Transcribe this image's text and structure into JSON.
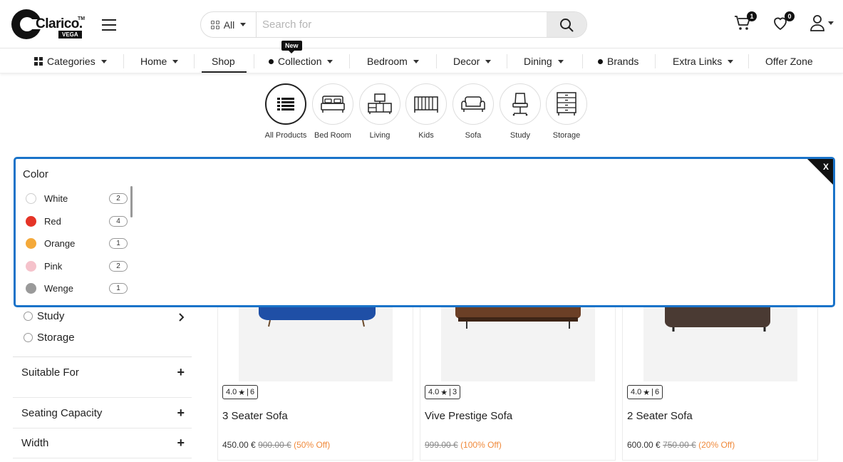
{
  "header": {
    "logo_text": "Clarico.",
    "logo_tm": "TM",
    "logo_sub": "VEGA",
    "search": {
      "category": "All",
      "placeholder": "Search for"
    },
    "cart_count": "1",
    "wishlist_count": "0"
  },
  "nav": {
    "categories": "Categories",
    "home": "Home",
    "shop": "Shop",
    "collection": "Collection",
    "new_badge": "New",
    "bedroom": "Bedroom",
    "decor": "Decor",
    "dining": "Dining",
    "brands": "Brands",
    "extra_links": "Extra Links",
    "offer_zone": "Offer Zone"
  },
  "categories": [
    {
      "label": "All Products",
      "icon": "list-icon"
    },
    {
      "label": "Bed Room",
      "icon": "bed-icon"
    },
    {
      "label": "Living",
      "icon": "tv-unit-icon"
    },
    {
      "label": "Kids",
      "icon": "crib-icon"
    },
    {
      "label": "Sofa",
      "icon": "sofa-icon"
    },
    {
      "label": "Study",
      "icon": "office-chair-icon"
    },
    {
      "label": "Storage",
      "icon": "cabinet-icon"
    }
  ],
  "filter_panel": {
    "title": "Color",
    "close": "X",
    "colors": [
      {
        "name": "White",
        "count": "2",
        "color": "#ffffff"
      },
      {
        "name": "Red",
        "count": "4",
        "color": "#e53427"
      },
      {
        "name": "Orange",
        "count": "1",
        "color": "#f4a93a"
      },
      {
        "name": "Pink",
        "count": "2",
        "color": "#f5c2cb"
      },
      {
        "name": "Wenge",
        "count": "1",
        "color": "#9a9a9a"
      }
    ]
  },
  "sidebar": {
    "options": [
      "Study",
      "Storage"
    ],
    "sections": [
      "Suitable For",
      "Seating Capacity",
      "Width"
    ]
  },
  "products": [
    {
      "rating": "4.0",
      "reviews": "6",
      "name": "3 Seater Sofa",
      "price": "450.00 €",
      "old_price": "900.00 €",
      "discount": "(50% Off)",
      "color": "#1f4fa6"
    },
    {
      "rating": "4.0",
      "reviews": "3",
      "name": "Vive Prestige Sofa",
      "price": "",
      "old_price": "999.00 €",
      "discount": "(100% Off)",
      "color": "#6b3f26"
    },
    {
      "rating": "4.0",
      "reviews": "6",
      "name": "2 Seater Sofa",
      "price": "600.00 €",
      "old_price": "750.00 €",
      "discount": "(20% Off)",
      "color": "#4a3a33"
    }
  ]
}
